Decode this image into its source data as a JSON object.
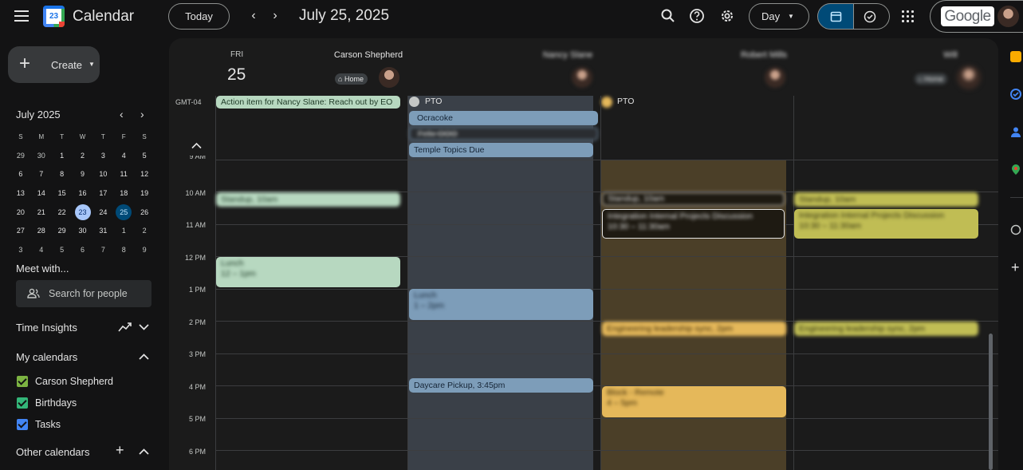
{
  "header": {
    "app_title": "Calendar",
    "logo_day": "23",
    "today_label": "Today",
    "date_title": "July 25, 2025",
    "view_label": "Day",
    "account_label": "Google",
    "icons": [
      "menu-icon",
      "search-icon",
      "help-icon",
      "gear-icon",
      "calendar-view-icon",
      "tasks-view-icon",
      "apps-grid-icon"
    ]
  },
  "sidebar": {
    "create_label": "Create",
    "mini_calendar": {
      "month_label": "July 2025",
      "weekday_headers": [
        "S",
        "M",
        "T",
        "W",
        "T",
        "F",
        "S"
      ],
      "weeks": [
        [
          "29",
          "30",
          "1",
          "2",
          "3",
          "4",
          "5"
        ],
        [
          "6",
          "7",
          "8",
          "9",
          "10",
          "11",
          "12"
        ],
        [
          "13",
          "14",
          "15",
          "16",
          "17",
          "18",
          "19"
        ],
        [
          "20",
          "21",
          "22",
          "23",
          "24",
          "25",
          "26"
        ],
        [
          "27",
          "28",
          "29",
          "30",
          "31",
          "1",
          "2"
        ],
        [
          "3",
          "4",
          "5",
          "6",
          "7",
          "8",
          "9"
        ]
      ],
      "today": "23",
      "selected": "25"
    },
    "meet_with_label": "Meet with...",
    "search_people_placeholder": "Search for people",
    "time_insights_label": "Time Insights",
    "my_calendars_label": "My calendars",
    "my_calendars": [
      {
        "name": "Carson Shepherd",
        "color": "#7cb342"
      },
      {
        "name": "Birthdays",
        "color": "#33b679"
      },
      {
        "name": "Tasks",
        "color": "#4285f4"
      }
    ],
    "other_calendars_label": "Other calendars"
  },
  "day_view": {
    "day_of_week": "FRI",
    "day_number": "25",
    "timezone_label": "GMT-04",
    "people": [
      {
        "name": "Carson Shepherd",
        "location_chip": "Home"
      },
      {
        "name": "Nancy Slane",
        "location_chip": ""
      },
      {
        "name": "Robert Mills",
        "location_chip": ""
      },
      {
        "name": "Will",
        "location_chip": "Home"
      }
    ],
    "hour_labels": [
      "9 AM",
      "10 AM",
      "11 AM",
      "12 PM",
      "1 PM",
      "2 PM",
      "3 PM",
      "4 PM",
      "5 PM",
      "6 PM"
    ],
    "all_day": {
      "carson": "Action item for Nancy Slane: Reach out by EO",
      "nancy_pto": "PTO",
      "nancy_items": [
        "Ocracoke",
        "Felix OOO",
        "Temple Topics Due"
      ],
      "robert_pto": "PTO"
    },
    "events": {
      "carson_standup": "Standup, 10am",
      "carson_lunch_title": "Lunch",
      "carson_lunch_time": "12 – 1pm",
      "nancy_lunch_title": "Lunch",
      "nancy_lunch_time": "1 – 2pm",
      "nancy_daycare": "Daycare Pickup, 3:45pm",
      "robert_standup": "Standup, 10am",
      "robert_integration_title": "Integration Internal Projects Discussion",
      "robert_integration_time": "10:30 – 11:30am",
      "robert_eng": "Engineering leadership sync, 2pm",
      "robert_block_title": "Block - Remote",
      "robert_block_time": "4 – 5pm",
      "will_standup": "Standup, 10am",
      "will_integration_title": "Integration Internal Projects Discussion",
      "will_integration_time": "10:30 – 11:30am",
      "will_eng": "Engineering leadership sync, 2pm"
    }
  },
  "colors": {
    "accent": "#a8c7fa",
    "selected": "#004a77",
    "carson_events": "#b7d8c0",
    "nancy_events": "#7d9db9",
    "robert_events": "#e5b85a",
    "will_events": "#c0bd54"
  }
}
